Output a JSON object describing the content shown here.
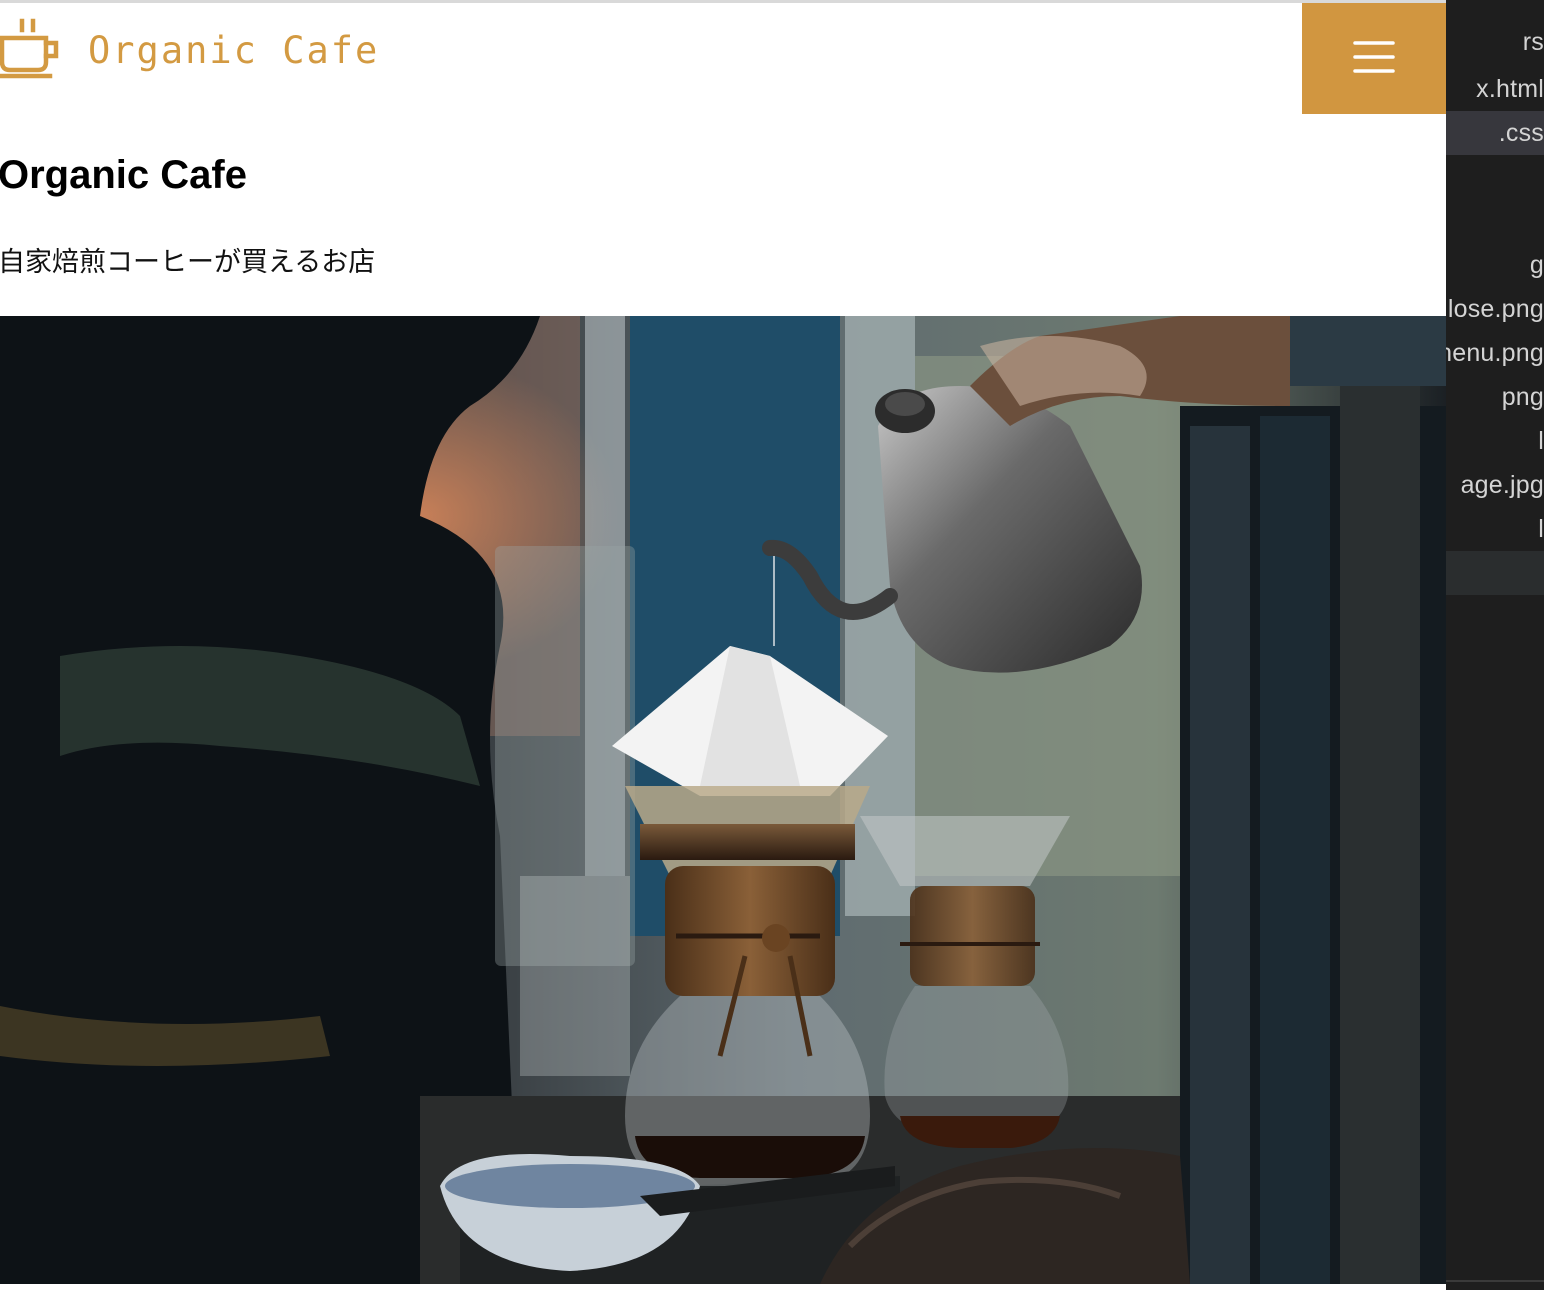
{
  "header": {
    "logo_text": "Organic Cafe",
    "menu_button_label": "menu"
  },
  "main": {
    "title": "Organic Cafe",
    "tagline": "自家焙煎コーヒーが買えるお店",
    "hero_image_alt": "coffee-pour-over-photo"
  },
  "editor_panel": {
    "items": [
      {
        "label": "rs"
      },
      {
        "label": "x.html"
      },
      {
        "label": ".css"
      },
      {
        "label": ""
      },
      {
        "label": "g"
      },
      {
        "label": "lose.png"
      },
      {
        "label": "nenu.png"
      },
      {
        "label": "png"
      },
      {
        "label": "l"
      },
      {
        "label": "age.jpg"
      },
      {
        "label": "l"
      }
    ]
  },
  "colors": {
    "brand_gold": "#d39a42",
    "menu_button_bg": "#d19640",
    "editor_bg": "#1e1e1e",
    "editor_selected": "#37373d"
  },
  "icons": {
    "logo_icon": "coffee-cup-icon",
    "menu_icon": "hamburger-menu-icon"
  }
}
